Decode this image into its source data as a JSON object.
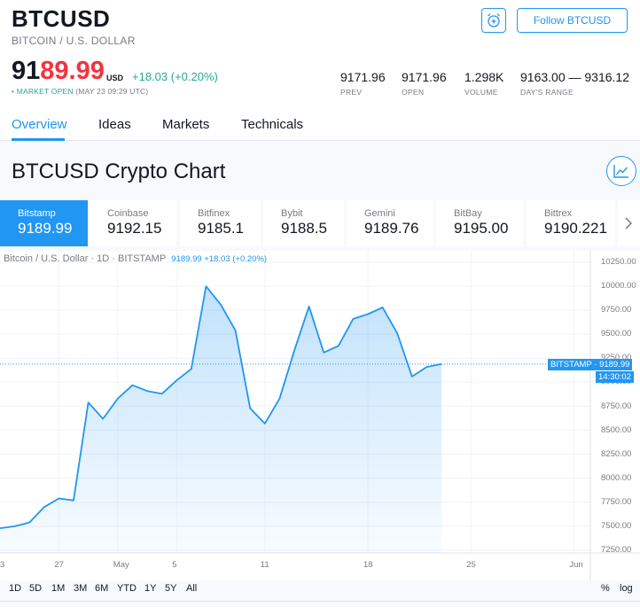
{
  "header": {
    "symbol": "BTCUSD",
    "description": "BITCOIN / U.S. DOLLAR",
    "follow_label": "Follow BTCUSD",
    "alarm_icon": "alarm-clock-plus-icon"
  },
  "quote": {
    "price_main": "91",
    "price_highlight": "89.99",
    "currency": "USD",
    "change": "+18.03 (+0.20%)",
    "market_status": "• MARKET OPEN",
    "market_time": "(MAY 23 09:29 UTC)",
    "stats": [
      {
        "value": "9171.96",
        "label": "PREV"
      },
      {
        "value": "9171.96",
        "label": "OPEN"
      },
      {
        "value": "1.298K",
        "label": "VOLUME"
      },
      {
        "value": "9163.00 — 9316.12",
        "label": "DAY'S RANGE"
      }
    ]
  },
  "tabs": [
    {
      "label": "Overview",
      "active": true
    },
    {
      "label": "Ideas",
      "active": false
    },
    {
      "label": "Markets",
      "active": false
    },
    {
      "label": "Technicals",
      "active": false
    }
  ],
  "chart_section": {
    "title": "BTCUSD Crypto Chart",
    "chart_icon": "chart-line-icon",
    "exchanges": [
      {
        "name": "Bitstamp",
        "value": "9189.99",
        "active": true
      },
      {
        "name": "Coinbase",
        "value": "9192.15",
        "active": false
      },
      {
        "name": "Bitfinex",
        "value": "9185.1",
        "active": false
      },
      {
        "name": "Bybit",
        "value": "9188.5",
        "active": false
      },
      {
        "name": "Gemini",
        "value": "9189.76",
        "active": false
      },
      {
        "name": "BitBay",
        "value": "9195.00",
        "active": false
      },
      {
        "name": "Bittrex",
        "value": "9190.221",
        "active": false
      }
    ],
    "next_icon": "chevron-right-icon"
  },
  "chart_data": {
    "type": "area",
    "legend_text": "Bitcoin / U.S. Dollar · 1D · BITSTAMP",
    "legend_value": "9189.99 +18.03 (+0.20%)",
    "x": [
      "Apr 23",
      "Apr 24",
      "Apr 25",
      "Apr 26",
      "Apr 27",
      "Apr 28",
      "Apr 29",
      "Apr 30",
      "May 1",
      "May 2",
      "May 3",
      "May 4",
      "May 5",
      "May 6",
      "May 7",
      "May 8",
      "May 9",
      "May 10",
      "May 11",
      "May 12",
      "May 13",
      "May 14",
      "May 15",
      "May 16",
      "May 17",
      "May 18",
      "May 19",
      "May 20",
      "May 21",
      "May 22",
      "May 23"
    ],
    "values": [
      7480,
      7500,
      7540,
      7700,
      7790,
      7770,
      8790,
      8620,
      8830,
      8970,
      8910,
      8880,
      9020,
      9140,
      10000,
      9810,
      9540,
      8730,
      8570,
      8830,
      9330,
      9790,
      9310,
      9380,
      9660,
      9710,
      9780,
      9510,
      9060,
      9160,
      9189.99
    ],
    "ylim": [
      7250,
      10250
    ],
    "y_ticks": [
      "10250.00",
      "10000.00",
      "9750.00",
      "9500.00",
      "9250.00",
      "9000.00",
      "8750.00",
      "8500.00",
      "8250.00",
      "8000.00",
      "7750.00",
      "7500.00",
      "7250.00"
    ],
    "x_ticks": [
      "3",
      "27",
      "May",
      "5",
      "11",
      "18",
      "25",
      "Jun"
    ],
    "last_value": 9189.99,
    "price_tag": "BITSTAMP · 9189.99",
    "countdown": "14:30:02",
    "color": "#2196f3",
    "grid": true
  },
  "ranges": [
    "1D",
    "5D",
    "1M",
    "3M",
    "6M",
    "YTD",
    "1Y",
    "5Y",
    "All"
  ],
  "scale_options": [
    "%",
    "log"
  ]
}
